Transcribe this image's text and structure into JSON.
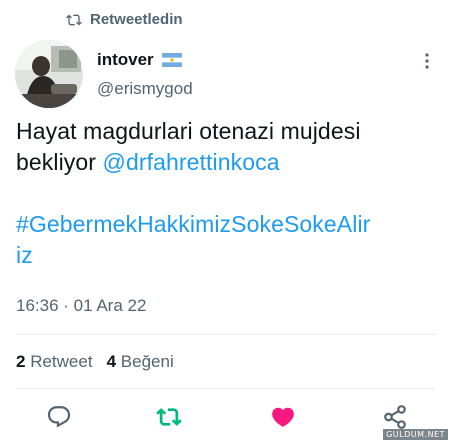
{
  "retweet_header": {
    "label": "Retweetledin",
    "icon": "retweet-icon"
  },
  "author": {
    "display_name": "intover",
    "handle": "@erismygod",
    "flag": "argentina-flag-icon"
  },
  "tweet": {
    "line1_text": "Hayat  magdurlari otenazi mujdesi",
    "line2_text": "bekliyor ",
    "mention": "@drfahrettinkoca",
    "hashtag_line1": "#GebermekHakkimizSokeSokeAlir",
    "hashtag_line2": "iz"
  },
  "timestamp": "16:36 · 01 Ara 22",
  "stats": {
    "retweet_count": "2",
    "retweet_label": "Retweet",
    "like_count": "4",
    "like_label": "Beğeni"
  },
  "actions": [
    "reply-icon",
    "retweet-icon",
    "like-icon",
    "share-icon"
  ],
  "colors": {
    "accent": "#1d9bf0",
    "retweet_green": "#00ba7c",
    "like_pink": "#f91880",
    "secondary_text": "#536471"
  },
  "watermark": "GULDUM.NET"
}
